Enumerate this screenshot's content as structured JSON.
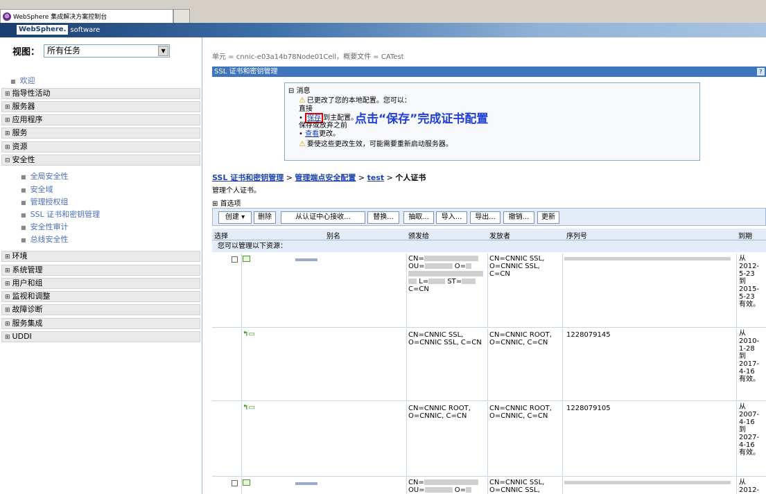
{
  "browser": {
    "tab_title": "WebSphere 集成解决方案控制台"
  },
  "banner": {
    "logo_brand": "WebSphere.",
    "logo_product": "software"
  },
  "nav": {
    "view_label": "视图：",
    "view_select": "所有任务",
    "welcome": "欢迎",
    "groups": [
      {
        "label": "指导性活动",
        "expanded": false
      },
      {
        "label": "服务器",
        "expanded": false
      },
      {
        "label": "应用程序",
        "expanded": false
      },
      {
        "label": "服务",
        "expanded": false
      },
      {
        "label": "资源",
        "expanded": false
      },
      {
        "label": "安全性",
        "expanded": true
      }
    ],
    "security_items": [
      "全局安全性",
      "安全域",
      "管理授权组",
      "SSL 证书和密钥管理",
      "安全性审计",
      "总线安全性"
    ],
    "groups_after": [
      {
        "label": "环境"
      },
      {
        "label": "系统管理"
      },
      {
        "label": "用户和组"
      },
      {
        "label": "监视和调整"
      },
      {
        "label": "故障诊断"
      },
      {
        "label": "服务集成"
      },
      {
        "label": "UDDI"
      }
    ]
  },
  "main": {
    "scope_crumb": "单元 = cnnic-e03a14b78Node01Cell，概要文件 = CATest",
    "panel_title": "SSL 证书和密钥管理",
    "help": "?",
    "messages": {
      "title": "消息",
      "line1": "已更改了您的本地配置。您可以：",
      "line2": "直接",
      "save_link": "保存",
      "line3_rest": "到主配置。",
      "line4": "保存或放弃之前",
      "view_link": "查看",
      "line5_rest": "更改。",
      "line6": "要使这些更改生效，可能需要重新启动服务器。",
      "annotation": "点击“保存”完成证书配置"
    },
    "breadcrumb": {
      "item1": "SSL 证书和密钥管理",
      "item2": "管理端点安全配置",
      "item3": "test",
      "current": "个人证书",
      "sep": ">"
    },
    "description": "管理个人证书。",
    "preferences": "首选项",
    "toolbar": {
      "create": "创建 ▾",
      "delete": "删除",
      "receive": "从认证中心接收...",
      "replace": "替换...",
      "extract": "抽取...",
      "import": "导入...",
      "export": "导出...",
      "revoke": "撤销...",
      "refresh": "更新"
    },
    "table": {
      "headers": {
        "select": "选择",
        "alias": "别名",
        "issued_to": "颁发给",
        "issued_by": "发放者",
        "serial": "序列号",
        "expires": "到期"
      },
      "subhead": "您可以管理以下资源：",
      "rows": [
        {
          "issued_to": [
            "CN=",
            "OU=",
            "O=",
            "L=",
            "ST=",
            "C=CN"
          ],
          "issued_by": [
            "CN=CNNIC SSL,",
            "O=CNNIC SSL,",
            "C=CN"
          ],
          "serial": "",
          "expires": [
            "从",
            "2012-",
            "5-23",
            "到",
            "2015-",
            "5-23",
            "有效。"
          ]
        },
        {
          "issued_to": [
            "CN=CNNIC SSL,",
            "O=CNNIC SSL, C=CN"
          ],
          "issued_by": [
            "CN=CNNIC ROOT,",
            "O=CNNIC, C=CN"
          ],
          "serial": "1228079145",
          "expires": [
            "从",
            "2010-",
            "1-28",
            "到",
            "2017-",
            "4-16",
            "有效。"
          ]
        },
        {
          "issued_to": [
            "CN=CNNIC ROOT,",
            "O=CNNIC, C=CN"
          ],
          "issued_by": [
            "CN=CNNIC ROOT,",
            "O=CNNIC, C=CN"
          ],
          "serial": "1228079105",
          "expires": [
            "从",
            "2007-",
            "4-16",
            "到",
            "2027-",
            "4-16",
            "有效。"
          ]
        },
        {
          "issued_to": [
            "CN=",
            "OU=",
            "O="
          ],
          "issued_by": [
            "CN=CNNIC SSL,",
            "O=CNNIC SSL,"
          ],
          "serial": "",
          "expires": [
            "从",
            "2012-"
          ]
        }
      ]
    }
  },
  "colors": {
    "banner_dark": "#1b3d6f",
    "panel_head": "#3f75bd",
    "link": "#1f44b0",
    "annotation": "#1f3fd6",
    "highlight_box": "#e00000"
  }
}
